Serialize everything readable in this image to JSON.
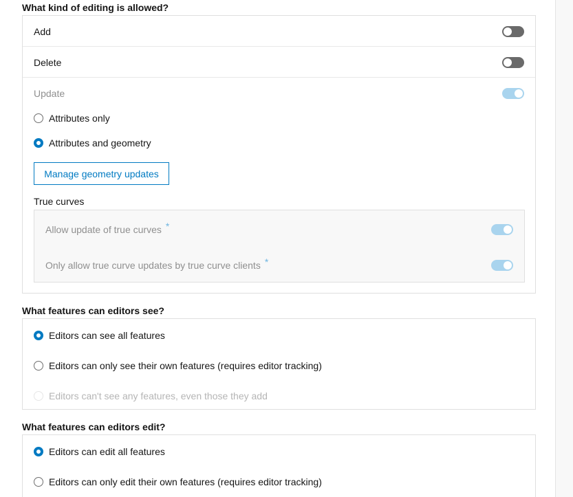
{
  "editing": {
    "heading": "What kind of editing is allowed?",
    "add_label": "Add",
    "delete_label": "Delete",
    "update_label": "Update",
    "attributes_only": "Attributes only",
    "attributes_and_geometry": "Attributes and geometry",
    "manage_button": "Manage geometry updates",
    "true_curves_label": "True curves",
    "allow_true_curves": "Allow update of true curves",
    "only_true_curve_clients": "Only allow true curve updates by true curve clients",
    "required_mark": "*"
  },
  "see": {
    "heading": "What features can editors see?",
    "options": [
      "Editors can see all features",
      "Editors can only see their own features (requires editor tracking)",
      "Editors can't see any features, even those they add"
    ]
  },
  "edit": {
    "heading": "What features can editors edit?",
    "options": [
      "Editors can edit all features",
      "Editors can only edit their own features (requires editor tracking)"
    ]
  },
  "colors": {
    "accent": "#007ac2",
    "toggle_off": "#6a6a6a",
    "toggle_on_disabled": "#a9d4ee"
  }
}
